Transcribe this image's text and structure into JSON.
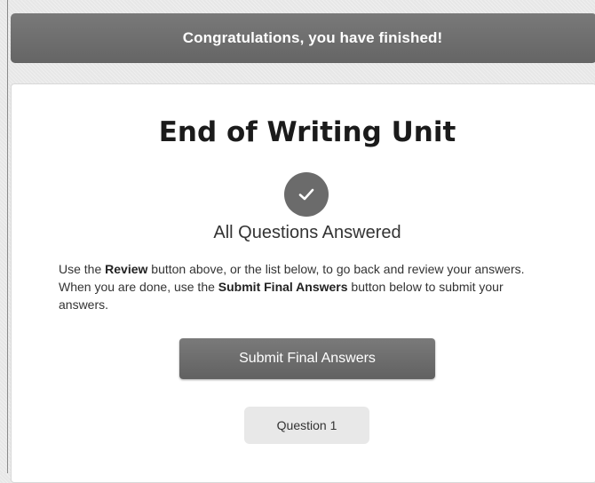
{
  "banner": {
    "text": "Congratulations, you have finished!"
  },
  "main": {
    "title": "End of Writing Unit",
    "status_icon": "check-icon",
    "status_text": "All Questions Answered",
    "instructions": {
      "part1": "Use the ",
      "review_bold": "Review",
      "part2": " button above, or the list below, to go back and review your answers. When you are done, use the ",
      "submit_bold": "Submit Final Answers",
      "part3": " button below to submit your answers."
    },
    "submit_button": "Submit Final Answers",
    "questions": [
      {
        "label": "Question 1"
      }
    ]
  },
  "colors": {
    "banner": "#6e6e6e",
    "button": "#6b6b6b",
    "question_button": "#e8e8e8",
    "card": "#ffffff"
  }
}
